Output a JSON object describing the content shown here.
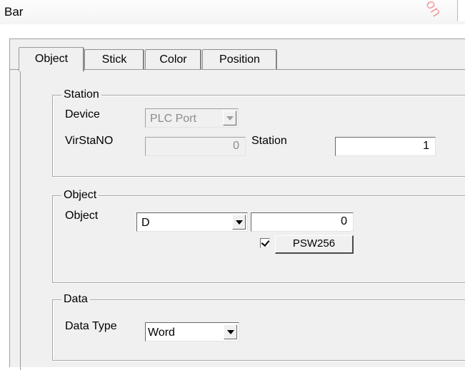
{
  "window": {
    "title": "Bar",
    "watermark": "on"
  },
  "tabs": [
    {
      "label": "Object",
      "active": true
    },
    {
      "label": "Stick",
      "active": false
    },
    {
      "label": "Color",
      "active": false
    },
    {
      "label": "Position",
      "active": false
    }
  ],
  "station_group": {
    "legend": "Station",
    "device_label": "Device",
    "device_value": "PLC Port",
    "virstano_label": "VirStaNO",
    "virstano_value": "0",
    "station_label": "Station",
    "station_value": "1"
  },
  "object_group": {
    "legend": "Object",
    "object_label": "Object",
    "object_type": "D",
    "object_address": "0",
    "address_checked": true,
    "address_button": "PSW256"
  },
  "data_group": {
    "legend": "Data",
    "data_type_label": "Data Type",
    "data_type_value": "Word"
  },
  "colors": {
    "dialog_bg": "#f0f0f0",
    "field_bg": "#ffffff",
    "disabled_text": "#8b8b8b",
    "watermark": "#f3a0a0"
  }
}
